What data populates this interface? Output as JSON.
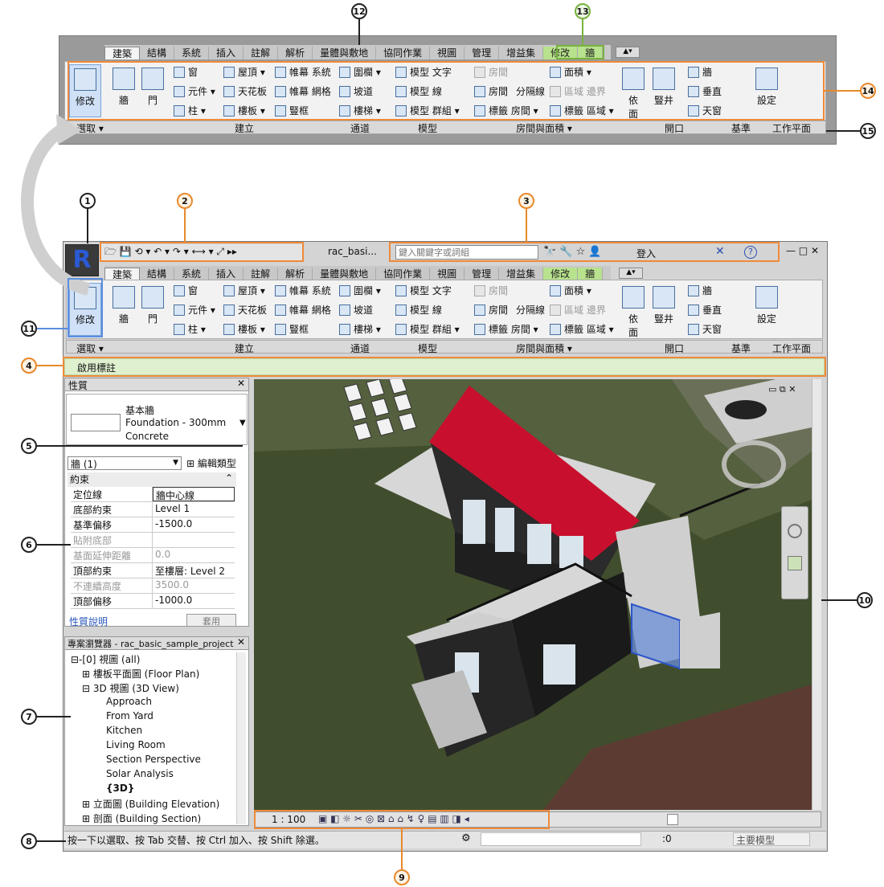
{
  "callouts": [
    "1",
    "2",
    "3",
    "4",
    "5",
    "6",
    "7",
    "8",
    "9",
    "10",
    "11",
    "12",
    "13",
    "14",
    "15"
  ],
  "tabs": [
    "建築",
    "結構",
    "系統",
    "插入",
    "註解",
    "解析",
    "量體與敷地",
    "協同作業",
    "視圖",
    "管理",
    "增益集",
    "修改",
    "牆"
  ],
  "ribbon": {
    "modify": "修改",
    "select": "選取 ▾",
    "build": {
      "label": "建立",
      "wall": "牆",
      "door": "門",
      "window": "窗",
      "component": "元件 ▾",
      "column": "柱 ▾",
      "roof": "屋頂 ▾",
      "ceiling": "天花板",
      "floor": "樓板 ▾",
      "curtain_system": "帷幕 系統",
      "curtain_grid": "帷幕 網格",
      "mullion": "豎框"
    },
    "circulation": {
      "label": "通道",
      "railing": "圍欄 ▾",
      "ramp": "坡道",
      "stair": "樓梯 ▾"
    },
    "model": {
      "label": "模型",
      "text": "模型 文字",
      "line": "模型 線",
      "group": "模型 群組 ▾"
    },
    "room": {
      "label": "房間與面積 ▾",
      "room": "房間",
      "room2": "房間",
      "separator": "分隔線",
      "tag_room": "標籤 房間 ▾",
      "area": "面積 ▾",
      "area_boundary": "區域 邊界",
      "tag_area": "標籤 區域 ▾"
    },
    "opening": {
      "label": "開口",
      "by_face": "依\n面",
      "shaft": "豎井",
      "wall": "牆",
      "vertical": "垂直",
      "dormer": "天窗"
    },
    "datum": {
      "label": "基準"
    },
    "workplane": {
      "label": "工作平面",
      "set": "設定"
    }
  },
  "app": {
    "filename": "rac_basi...",
    "search_placeholder": "鍵入關鍵字或詞組",
    "signin": "登入",
    "help": "?"
  },
  "options_bar": {
    "label": "啟用標註"
  },
  "properties": {
    "title": "性質",
    "type_line1": "基本牆",
    "type_line2": "Foundation - 300mm",
    "type_line3": "Concrete",
    "instance": "牆 (1)",
    "edit_type": "編輯類型",
    "section": "約束",
    "rows": [
      {
        "name": "定位線",
        "value": "牆中心線",
        "dim": false
      },
      {
        "name": "底部約束",
        "value": "Level 1",
        "dim": false
      },
      {
        "name": "基準偏移",
        "value": "-1500.0",
        "dim": false
      },
      {
        "name": "貼附底部",
        "value": "",
        "dim": true
      },
      {
        "name": "基面延伸距離",
        "value": "0.0",
        "dim": true
      },
      {
        "name": "頂部約束",
        "value": "至樓層: Level 2",
        "dim": false
      },
      {
        "name": "不連續高度",
        "value": "3500.0",
        "dim": true
      },
      {
        "name": "頂部偏移",
        "value": "-1000.0",
        "dim": false
      }
    ],
    "help": "性質說明",
    "apply": "套用"
  },
  "browser": {
    "title": "專案瀏覽器 - rac_basic_sample_project",
    "items": [
      {
        "t": "⊟-[0] 視圖 (all)",
        "i": 0
      },
      {
        "t": "⊞ 樓板平面圖 (Floor Plan)",
        "i": 1
      },
      {
        "t": "⊟ 3D 視圖 (3D View)",
        "i": 1
      },
      {
        "t": "Approach",
        "i": 2
      },
      {
        "t": "From Yard",
        "i": 2
      },
      {
        "t": "Kitchen",
        "i": 2
      },
      {
        "t": "Living Room",
        "i": 2
      },
      {
        "t": "Section Perspective",
        "i": 2
      },
      {
        "t": "Solar Analysis",
        "i": 2
      },
      {
        "t": "{3D}",
        "i": 2
      },
      {
        "t": "⊞ 立面圖 (Building Elevation)",
        "i": 1
      },
      {
        "t": "⊞ 剖面 (Building Section)",
        "i": 1
      }
    ]
  },
  "viewbar": {
    "scale": "1 : 100"
  },
  "status": {
    "text": "按一下以選取、按 Tab 交替、按 Ctrl 加入、按 Shift 除選。",
    "count": ":0",
    "model": "主要模型"
  },
  "colors": {
    "roof": "#c8102e",
    "ground": "#3c4a2a",
    "highlight": "#ef8a3a",
    "green": "#77b340"
  }
}
